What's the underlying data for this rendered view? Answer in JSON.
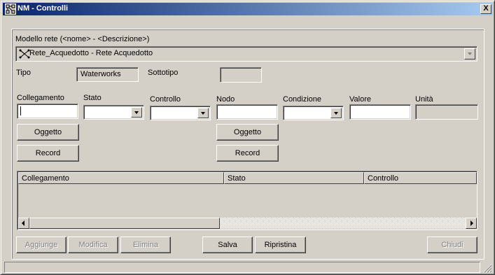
{
  "window": {
    "title": "NM - Controlli",
    "close_label": "X",
    "icon": "network-model-icon"
  },
  "model": {
    "label": "Modello rete (<nome> - <Descrizione>)",
    "value": "Rete_Acquedotto - Rete Acquedotto",
    "icon": "network-graph-icon"
  },
  "tipo": {
    "label": "Tipo",
    "value": "Waterworks"
  },
  "sottotipo": {
    "label": "Sottotipo",
    "value": ""
  },
  "fields": {
    "collegamento": {
      "label": "Collegamento",
      "value": ""
    },
    "stato": {
      "label": "Stato",
      "value": ""
    },
    "controllo": {
      "label": "Controllo",
      "value": ""
    },
    "nodo": {
      "label": "Nodo",
      "value": ""
    },
    "condizione": {
      "label": "Condizione",
      "value": ""
    },
    "valore": {
      "label": "Valore",
      "value": ""
    },
    "unita": {
      "label": "Unità",
      "value": ""
    }
  },
  "left_buttons": {
    "oggetto": "Oggetto",
    "record": "Record"
  },
  "right_buttons": {
    "oggetto": "Oggetto",
    "record": "Record"
  },
  "table": {
    "columns": [
      "Collegamento",
      "Stato",
      "Controllo"
    ],
    "rows": []
  },
  "bottom_buttons": {
    "aggiunge": "Aggiunge",
    "modifica": "Modifica",
    "elimina": "Elimina",
    "salva": "Salva",
    "ripristina": "Ripristina",
    "chiudi": "Chiudi"
  },
  "colors": {
    "title_start": "#0a246a",
    "title_end": "#a6caf0",
    "face": "#d4d0c8",
    "disabled_text": "#808080"
  }
}
